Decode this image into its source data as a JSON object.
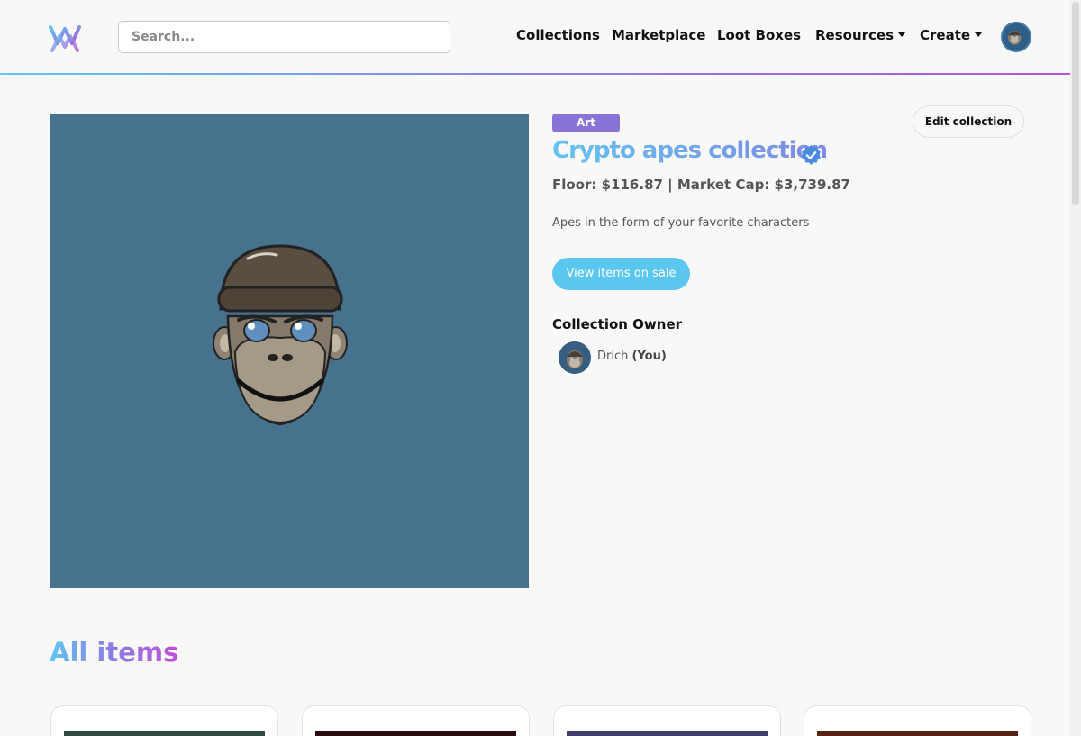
{
  "navbar": {
    "search_placeholder": "Search...",
    "links": [
      "Collections",
      "Marketplace",
      "Loot Boxes",
      "Resources",
      "Create"
    ]
  },
  "collection": {
    "category": "Art",
    "title": "Crypto apes collection",
    "verified": true,
    "stats": "Floor: $116.87 | Market Cap: $3,739.87",
    "description": "Apes in the form of your favorite characters",
    "edit_label": "Edit collection",
    "sale_label": "View items on sale",
    "image_bg": "#46728e"
  },
  "owner": {
    "heading": "Collection Owner",
    "name": "Drich",
    "you_label": "(You)"
  },
  "items_section": {
    "title": "All items",
    "card_colors": [
      "#2e4a42",
      "#2a0c0e",
      "#403d66",
      "#5a2318"
    ]
  },
  "colors": {
    "accent_blue": "#5bc6ef",
    "accent_purple": "#8a73d8",
    "gradient_pink": "#bf4fd8"
  }
}
